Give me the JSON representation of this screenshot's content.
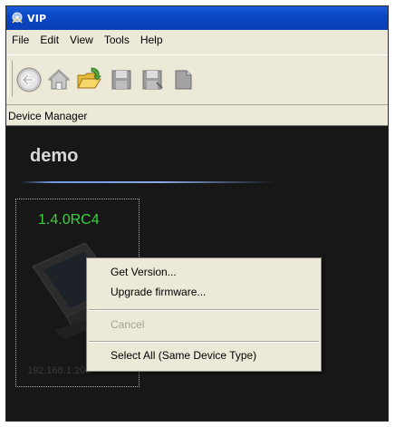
{
  "window": {
    "title": "VIP"
  },
  "menubar": {
    "items": [
      "File",
      "Edit",
      "View",
      "Tools",
      "Help"
    ]
  },
  "toolbar": {
    "buttons": [
      "back-icon",
      "home-icon",
      "open-folder-icon",
      "save-icon",
      "save-as-icon",
      "page-icon"
    ]
  },
  "device_manager": {
    "label": "Device Manager"
  },
  "group": {
    "name": "demo"
  },
  "device": {
    "version": "1.4.0RC4",
    "ip": "192.168.1.200"
  },
  "context_menu": {
    "get_version": "Get Version...",
    "upgrade_firmware": "Upgrade firmware...",
    "cancel": "Cancel",
    "select_all": "Select All (Same Device Type)"
  },
  "colors": {
    "title_bar": "#0a47c4",
    "canvas_bg": "#171717",
    "version_text": "#3bd23b",
    "tile_border": "#c8b030"
  }
}
